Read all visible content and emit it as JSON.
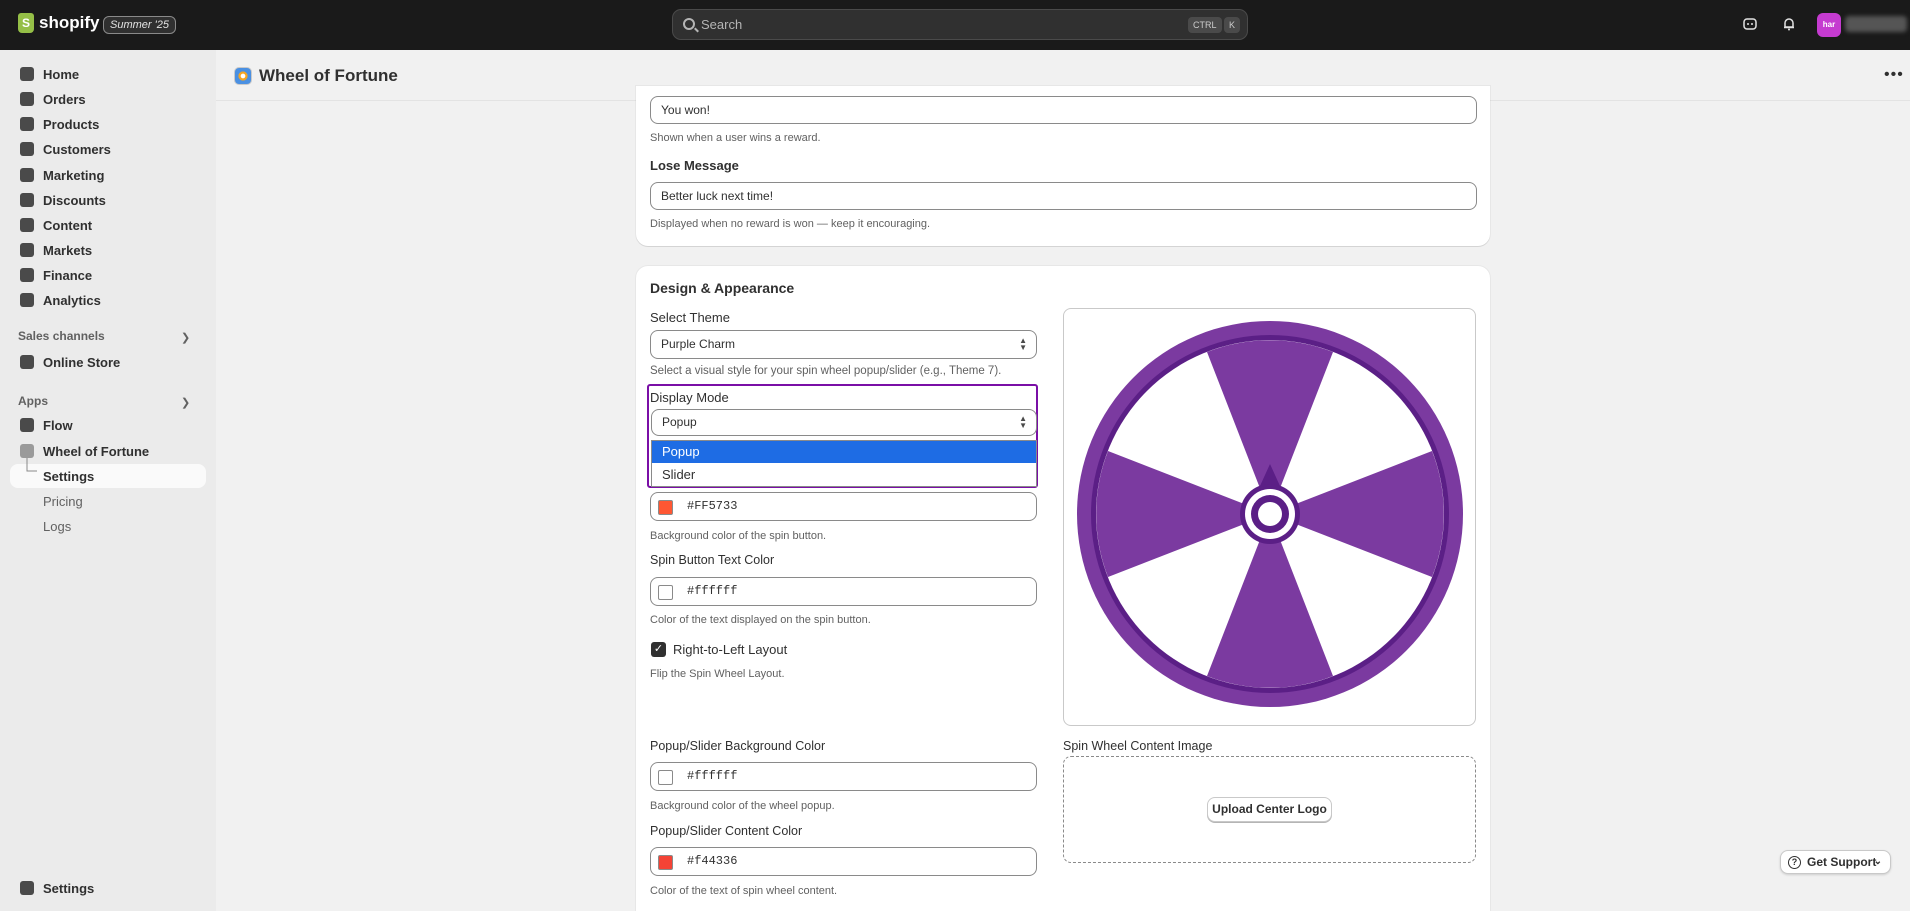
{
  "topbar": {
    "brand": "shopify",
    "badge": "Summer '25",
    "search_placeholder": "Search",
    "shortcut_ctrl": "CTRL",
    "shortcut_key": "K",
    "avatar_initials": "har"
  },
  "sidebar": {
    "items": [
      {
        "label": "Home",
        "icon": "home-icon"
      },
      {
        "label": "Orders",
        "icon": "orders-icon"
      },
      {
        "label": "Products",
        "icon": "tag-icon"
      },
      {
        "label": "Customers",
        "icon": "person-icon"
      },
      {
        "label": "Marketing",
        "icon": "target-icon"
      },
      {
        "label": "Discounts",
        "icon": "discount-icon"
      },
      {
        "label": "Content",
        "icon": "content-icon"
      },
      {
        "label": "Markets",
        "icon": "globe-icon"
      },
      {
        "label": "Finance",
        "icon": "bank-icon"
      },
      {
        "label": "Analytics",
        "icon": "bar-chart-icon"
      }
    ],
    "sales_channels_title": "Sales channels",
    "online_store": "Online Store",
    "apps_title": "Apps",
    "flow": "Flow",
    "wheel_of_fortune": "Wheel of Fortune",
    "app_sub": [
      "Settings",
      "Pricing",
      "Logs"
    ],
    "settings": "Settings"
  },
  "page": {
    "title": "Wheel of Fortune"
  },
  "messages_card": {
    "win_value": "You won!",
    "win_help": "Shown when a user wins a reward.",
    "lose_label": "Lose Message",
    "lose_value": "Better luck next time!",
    "lose_help": "Displayed when no reward is won — keep it encouraging."
  },
  "design_card": {
    "heading": "Design & Appearance",
    "theme_label": "Select Theme",
    "theme_value": "Purple Charm",
    "theme_help": "Select a visual style for your spin wheel popup/slider (e.g., Theme 7).",
    "display_label": "Display Mode",
    "display_value": "Popup",
    "display_options": [
      "Popup",
      "Slider"
    ],
    "spin_bg_value": "#FF5733",
    "spin_bg_help": "Background color of the spin button.",
    "spin_text_label": "Spin Button Text Color",
    "spin_text_value": "#ffffff",
    "spin_text_help": "Color of the text displayed on the spin button.",
    "rtl_label": "Right-to-Left Layout",
    "rtl_checked": true,
    "rtl_help": "Flip the Spin Wheel Layout.",
    "popup_bg_label": "Popup/Slider Background Color",
    "popup_bg_value": "#ffffff",
    "popup_bg_help": "Background color of the wheel popup.",
    "popup_content_label": "Popup/Slider Content Color",
    "popup_content_value": "#f44336",
    "popup_content_help": "Color of the text of spin wheel content.",
    "content_image_label": "Spin Wheel Content Image",
    "upload_button": "Upload Center Logo"
  },
  "support": "Get Support",
  "colors": {
    "wheel_purple": "#7b3aa0",
    "wheel_dark": "#5b1f86",
    "spin_bg": "#FF5733",
    "content_color": "#f44336",
    "dropdown_selected": "#1e6ce4",
    "highlight": "#7a0fa6"
  }
}
